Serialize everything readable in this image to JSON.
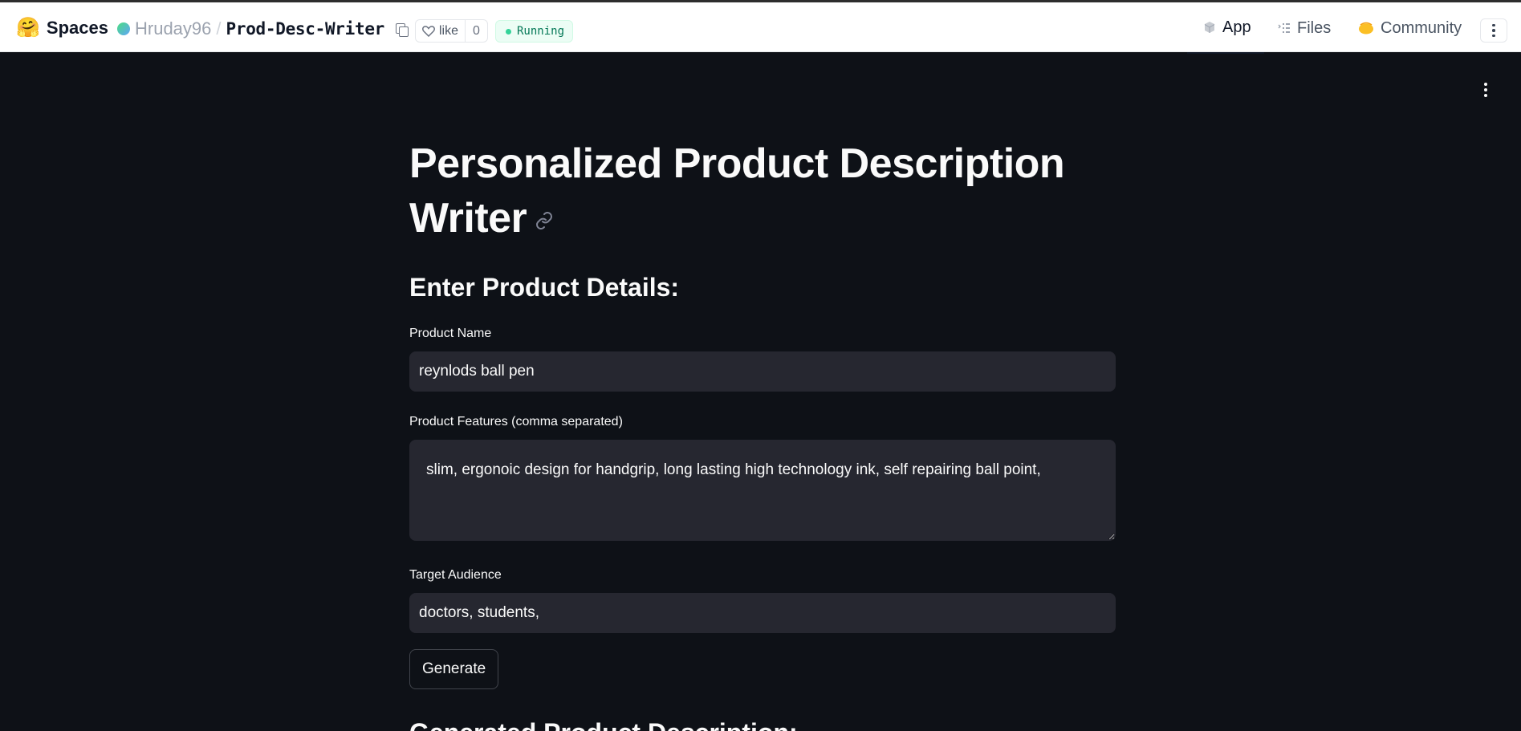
{
  "header": {
    "brand_icon": "🤗",
    "brand_label": "Spaces",
    "owner": "Hruday96",
    "separator": "/",
    "repo": "Prod-Desc-Writer",
    "like_label": "like",
    "like_count": "0",
    "status": "Running",
    "tabs": [
      {
        "label": "App",
        "icon": "cube-icon",
        "active": true
      },
      {
        "label": "Files",
        "icon": "files-icon",
        "active": false
      },
      {
        "label": "Community",
        "icon": "community-icon",
        "active": false
      }
    ]
  },
  "app": {
    "title": "Personalized Product Description Writer",
    "section_heading": "Enter Product Details:",
    "fields": {
      "product_name": {
        "label": "Product Name",
        "value": "reynlods ball pen"
      },
      "product_features": {
        "label": "Product Features (comma separated)",
        "value": "slim, ergonoic design for handgrip, long lasting high technology ink, self repairing ball point,"
      },
      "target_audience": {
        "label": "Target Audience",
        "value": "doctors, students,"
      }
    },
    "generate_label": "Generate",
    "output_heading": "Generated Product Description:"
  },
  "colors": {
    "app_background": "#0e1117",
    "input_background": "#262730",
    "text": "#fafafa",
    "running_badge": "#047857"
  }
}
